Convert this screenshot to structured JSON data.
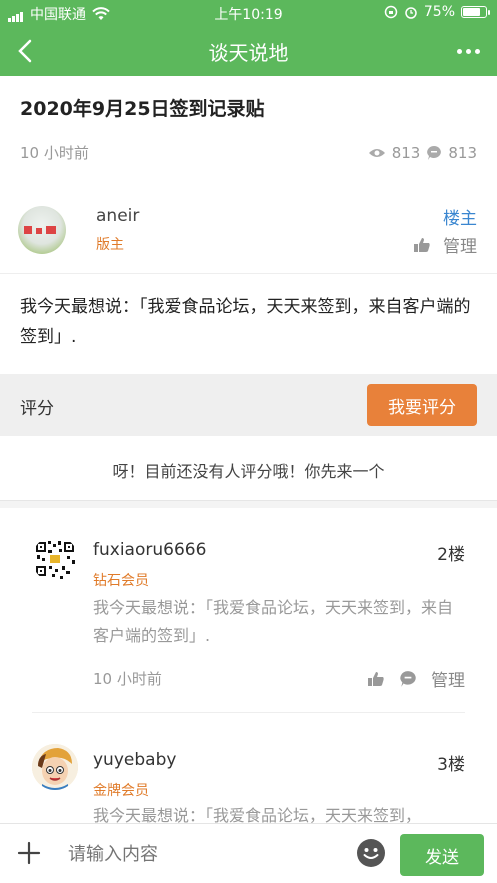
{
  "status": {
    "carrier": "中国联通",
    "time": "上午10:19",
    "battery": "75%",
    "battery_level": 0.75
  },
  "nav": {
    "title": "谈天说地"
  },
  "post": {
    "title": "2020年9月25日签到记录贴",
    "time": "10 小时前",
    "views": "813",
    "comments": "813",
    "author": {
      "name": "aneir",
      "role": "版主",
      "tag": "楼主",
      "manage": "管理"
    },
    "body": "我今天最想说：「我爱食品论坛，天天来签到，来自客户端的签到」."
  },
  "rating": {
    "label": "评分",
    "button": "我要评分",
    "empty": "呀！目前还没有人评分哦！你先来一个"
  },
  "replies": [
    {
      "name": "fuxiaoru6666",
      "floor": "2楼",
      "badge": "钻石会员",
      "content": "我今天最想说：「我爱食品论坛，天天来签到，来自客户端的签到」.",
      "time": "10 小时前",
      "manage": "管理"
    },
    {
      "name": "yuyebaby",
      "floor": "3楼",
      "badge": "金牌会员",
      "content": "我今天最想说：「我爱食品论坛，天天来签到，"
    }
  ],
  "input": {
    "placeholder": "请输入内容",
    "send": "发送"
  },
  "colors": {
    "brand": "#5cb85c",
    "accent": "#e8813a",
    "link": "#3a86d0"
  }
}
